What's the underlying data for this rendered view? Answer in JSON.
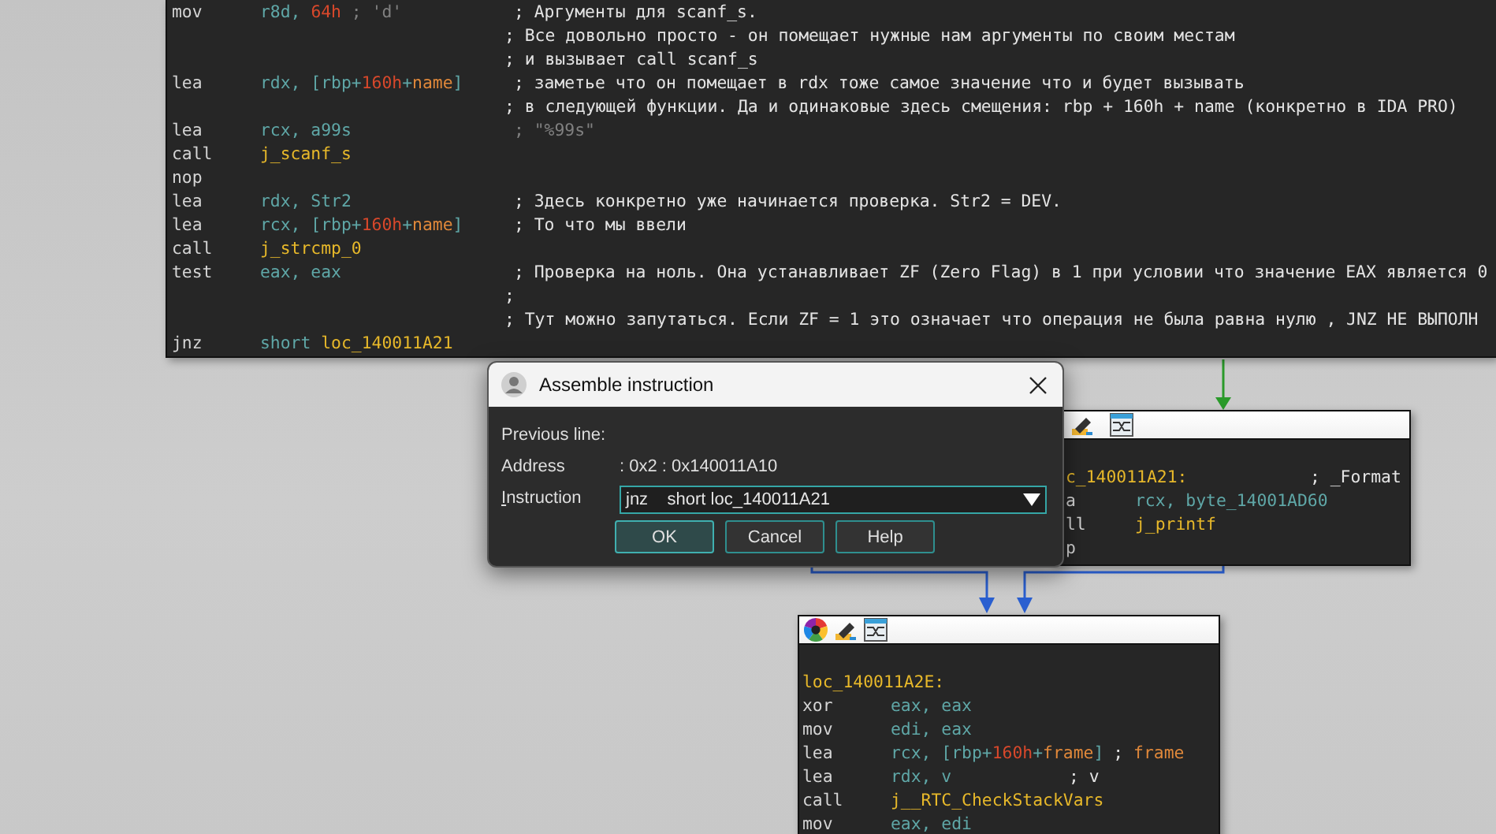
{
  "top_block": {
    "lines": [
      {
        "kind": "code",
        "mnemonic": "mov",
        "operand": [
          {
            "text": "r8d, ",
            "kind": "reg"
          },
          {
            "text": "64h",
            "kind": "num"
          },
          {
            "text": " ; 'd'",
            "kind": "dim"
          }
        ],
        "comment": [
          {
            "text": "; Аргументы для scanf_s.",
            "kind": "cm"
          }
        ]
      },
      {
        "kind": "code",
        "comment": [
          {
            "text": "; Все довольно просто - он помещает нужные нам аргументы по своим местам",
            "kind": "cm"
          }
        ]
      },
      {
        "kind": "code",
        "comment": [
          {
            "text": "; и вызывает call scanf_s",
            "kind": "cm"
          }
        ]
      },
      {
        "kind": "code",
        "mnemonic": "lea",
        "operand": [
          {
            "text": "rdx, [rbp+",
            "kind": "reg"
          },
          {
            "text": "160h",
            "kind": "num"
          },
          {
            "text": "+",
            "kind": "reg"
          },
          {
            "text": "name",
            "kind": "name"
          },
          {
            "text": "]",
            "kind": "reg"
          }
        ],
        "comment": [
          {
            "text": "; заметье что он помещает в rdx тоже самое значение что и будет вызывать",
            "kind": "cm"
          }
        ]
      },
      {
        "kind": "code",
        "comment": [
          {
            "text": "; в следующей функции. Да и одинаковые здесь смещения: rbp + 160h + name (конкретно в IDA PRO)",
            "kind": "cm"
          }
        ]
      },
      {
        "kind": "code",
        "mnemonic": "lea",
        "operand": [
          {
            "text": "rcx, a99s",
            "kind": "reg"
          }
        ],
        "comment": [
          {
            "text": "; \"%99s\"",
            "kind": "dim"
          }
        ]
      },
      {
        "kind": "code",
        "mnemonic": "call",
        "operand": [
          {
            "text": "j_scanf_s",
            "kind": "func"
          }
        ]
      },
      {
        "kind": "code",
        "mnemonic": "nop"
      },
      {
        "kind": "code",
        "mnemonic": "lea",
        "operand": [
          {
            "text": "rdx, Str2",
            "kind": "reg"
          }
        ],
        "comment": [
          {
            "text": "; Здесь конкретно уже начинается проверка. Str2 = DEV.",
            "kind": "cm"
          }
        ]
      },
      {
        "kind": "code",
        "mnemonic": "lea",
        "operand": [
          {
            "text": "rcx, [rbp+",
            "kind": "reg"
          },
          {
            "text": "160h",
            "kind": "num"
          },
          {
            "text": "+",
            "kind": "reg"
          },
          {
            "text": "name",
            "kind": "name"
          },
          {
            "text": "]",
            "kind": "reg"
          }
        ],
        "comment": [
          {
            "text": "; То что мы ввели",
            "kind": "cm"
          }
        ]
      },
      {
        "kind": "code",
        "mnemonic": "call",
        "operand": [
          {
            "text": "j_strcmp_0",
            "kind": "func"
          }
        ]
      },
      {
        "kind": "code",
        "mnemonic": "test",
        "operand": [
          {
            "text": "eax, eax",
            "kind": "reg"
          }
        ],
        "comment": [
          {
            "text": "; Проверка на ноль. Она устанавливает ZF (Zero Flag) в 1 при условии что значение EAX является 0",
            "kind": "cm"
          }
        ]
      },
      {
        "kind": "code",
        "comment": [
          {
            "text": ";",
            "kind": "cm"
          }
        ]
      },
      {
        "kind": "code",
        "comment": [
          {
            "text": "; Тут можно запутаться. Если ZF = 1 это означает что операция не была равна нулю , JNZ НЕ ВЫПОЛН",
            "kind": "cm"
          }
        ]
      },
      {
        "kind": "code",
        "mnemonic": "jnz",
        "operand": [
          {
            "text": "short ",
            "kind": "reg"
          },
          {
            "text": "loc_140011A21",
            "kind": "func"
          }
        ]
      }
    ]
  },
  "dialog": {
    "title": "Assemble instruction",
    "previous_line_label": "Previous line:",
    "address_label": "Address",
    "address_value": ": 0x2 : 0x140011A10",
    "instruction_label": "Instruction",
    "instruction_value": "jnz    short loc_140011A21",
    "buttons": [
      {
        "label": "OK",
        "selected": true
      },
      {
        "label": "Cancel",
        "selected": false
      },
      {
        "label": "Help",
        "selected": false
      }
    ]
  },
  "right_node": {
    "lines": [
      {
        "kind": "label",
        "label": "c_140011A21:",
        "comment": [
          {
            "text": "; _Format",
            "kind": "cm"
          }
        ]
      },
      {
        "kind": "code",
        "mnemonic": "a",
        "operand": [
          {
            "text": "rcx, byte_14001AD60",
            "kind": "reg"
          }
        ]
      },
      {
        "kind": "code",
        "mnemonic": "ll",
        "operand": [
          {
            "text": "j_printf",
            "kind": "func"
          }
        ]
      },
      {
        "kind": "code",
        "mnemonic": "p"
      }
    ]
  },
  "bottom_node": {
    "lines": [
      {
        "kind": "label",
        "label": "loc_140011A2E:"
      },
      {
        "kind": "code",
        "mnemonic": "xor",
        "operand": [
          {
            "text": "eax, eax",
            "kind": "reg"
          }
        ]
      },
      {
        "kind": "code",
        "mnemonic": "mov",
        "operand": [
          {
            "text": "edi, eax",
            "kind": "reg"
          }
        ]
      },
      {
        "kind": "code",
        "mnemonic": "lea",
        "operand": [
          {
            "text": "rcx, [rbp+",
            "kind": "reg"
          },
          {
            "text": "160h",
            "kind": "num"
          },
          {
            "text": "+",
            "kind": "reg"
          },
          {
            "text": "frame",
            "kind": "name"
          },
          {
            "text": "]",
            "kind": "reg"
          }
        ],
        "comment": [
          {
            "text": "; ",
            "kind": "cm"
          },
          {
            "text": "frame",
            "kind": "name"
          }
        ]
      },
      {
        "kind": "code",
        "mnemonic": "lea",
        "operand": [
          {
            "text": "rdx, v",
            "kind": "reg"
          }
        ],
        "comment": [
          {
            "text": "; v",
            "kind": "cm"
          }
        ]
      },
      {
        "kind": "code",
        "mnemonic": "call",
        "operand": [
          {
            "text": "j__RTC_CheckStackVars",
            "kind": "func"
          }
        ]
      },
      {
        "kind": "code",
        "mnemonic": "mov",
        "operand": [
          {
            "text": "eax, edi",
            "kind": "reg"
          }
        ]
      }
    ]
  }
}
